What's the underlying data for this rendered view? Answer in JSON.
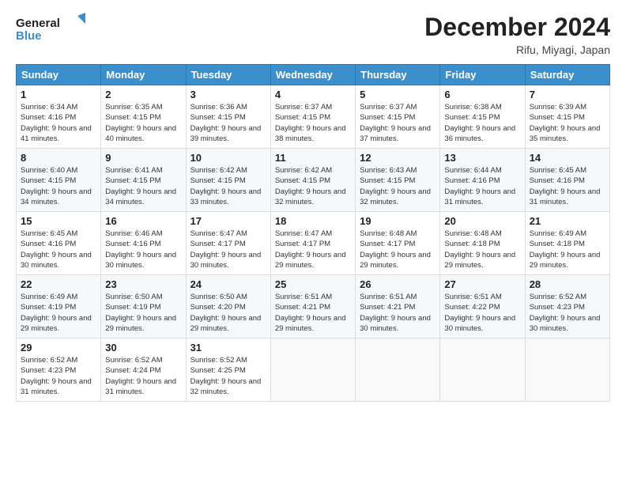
{
  "header": {
    "logo_line1": "General",
    "logo_line2": "Blue",
    "month_title": "December 2024",
    "location": "Rifu, Miyagi, Japan"
  },
  "days_of_week": [
    "Sunday",
    "Monday",
    "Tuesday",
    "Wednesday",
    "Thursday",
    "Friday",
    "Saturday"
  ],
  "weeks": [
    [
      {
        "day": "1",
        "sunrise": "Sunrise: 6:34 AM",
        "sunset": "Sunset: 4:16 PM",
        "daylight": "Daylight: 9 hours and 41 minutes."
      },
      {
        "day": "2",
        "sunrise": "Sunrise: 6:35 AM",
        "sunset": "Sunset: 4:15 PM",
        "daylight": "Daylight: 9 hours and 40 minutes."
      },
      {
        "day": "3",
        "sunrise": "Sunrise: 6:36 AM",
        "sunset": "Sunset: 4:15 PM",
        "daylight": "Daylight: 9 hours and 39 minutes."
      },
      {
        "day": "4",
        "sunrise": "Sunrise: 6:37 AM",
        "sunset": "Sunset: 4:15 PM",
        "daylight": "Daylight: 9 hours and 38 minutes."
      },
      {
        "day": "5",
        "sunrise": "Sunrise: 6:37 AM",
        "sunset": "Sunset: 4:15 PM",
        "daylight": "Daylight: 9 hours and 37 minutes."
      },
      {
        "day": "6",
        "sunrise": "Sunrise: 6:38 AM",
        "sunset": "Sunset: 4:15 PM",
        "daylight": "Daylight: 9 hours and 36 minutes."
      },
      {
        "day": "7",
        "sunrise": "Sunrise: 6:39 AM",
        "sunset": "Sunset: 4:15 PM",
        "daylight": "Daylight: 9 hours and 35 minutes."
      }
    ],
    [
      {
        "day": "8",
        "sunrise": "Sunrise: 6:40 AM",
        "sunset": "Sunset: 4:15 PM",
        "daylight": "Daylight: 9 hours and 34 minutes."
      },
      {
        "day": "9",
        "sunrise": "Sunrise: 6:41 AM",
        "sunset": "Sunset: 4:15 PM",
        "daylight": "Daylight: 9 hours and 34 minutes."
      },
      {
        "day": "10",
        "sunrise": "Sunrise: 6:42 AM",
        "sunset": "Sunset: 4:15 PM",
        "daylight": "Daylight: 9 hours and 33 minutes."
      },
      {
        "day": "11",
        "sunrise": "Sunrise: 6:42 AM",
        "sunset": "Sunset: 4:15 PM",
        "daylight": "Daylight: 9 hours and 32 minutes."
      },
      {
        "day": "12",
        "sunrise": "Sunrise: 6:43 AM",
        "sunset": "Sunset: 4:15 PM",
        "daylight": "Daylight: 9 hours and 32 minutes."
      },
      {
        "day": "13",
        "sunrise": "Sunrise: 6:44 AM",
        "sunset": "Sunset: 4:16 PM",
        "daylight": "Daylight: 9 hours and 31 minutes."
      },
      {
        "day": "14",
        "sunrise": "Sunrise: 6:45 AM",
        "sunset": "Sunset: 4:16 PM",
        "daylight": "Daylight: 9 hours and 31 minutes."
      }
    ],
    [
      {
        "day": "15",
        "sunrise": "Sunrise: 6:45 AM",
        "sunset": "Sunset: 4:16 PM",
        "daylight": "Daylight: 9 hours and 30 minutes."
      },
      {
        "day": "16",
        "sunrise": "Sunrise: 6:46 AM",
        "sunset": "Sunset: 4:16 PM",
        "daylight": "Daylight: 9 hours and 30 minutes."
      },
      {
        "day": "17",
        "sunrise": "Sunrise: 6:47 AM",
        "sunset": "Sunset: 4:17 PM",
        "daylight": "Daylight: 9 hours and 30 minutes."
      },
      {
        "day": "18",
        "sunrise": "Sunrise: 6:47 AM",
        "sunset": "Sunset: 4:17 PM",
        "daylight": "Daylight: 9 hours and 29 minutes."
      },
      {
        "day": "19",
        "sunrise": "Sunrise: 6:48 AM",
        "sunset": "Sunset: 4:17 PM",
        "daylight": "Daylight: 9 hours and 29 minutes."
      },
      {
        "day": "20",
        "sunrise": "Sunrise: 6:48 AM",
        "sunset": "Sunset: 4:18 PM",
        "daylight": "Daylight: 9 hours and 29 minutes."
      },
      {
        "day": "21",
        "sunrise": "Sunrise: 6:49 AM",
        "sunset": "Sunset: 4:18 PM",
        "daylight": "Daylight: 9 hours and 29 minutes."
      }
    ],
    [
      {
        "day": "22",
        "sunrise": "Sunrise: 6:49 AM",
        "sunset": "Sunset: 4:19 PM",
        "daylight": "Daylight: 9 hours and 29 minutes."
      },
      {
        "day": "23",
        "sunrise": "Sunrise: 6:50 AM",
        "sunset": "Sunset: 4:19 PM",
        "daylight": "Daylight: 9 hours and 29 minutes."
      },
      {
        "day": "24",
        "sunrise": "Sunrise: 6:50 AM",
        "sunset": "Sunset: 4:20 PM",
        "daylight": "Daylight: 9 hours and 29 minutes."
      },
      {
        "day": "25",
        "sunrise": "Sunrise: 6:51 AM",
        "sunset": "Sunset: 4:21 PM",
        "daylight": "Daylight: 9 hours and 29 minutes."
      },
      {
        "day": "26",
        "sunrise": "Sunrise: 6:51 AM",
        "sunset": "Sunset: 4:21 PM",
        "daylight": "Daylight: 9 hours and 30 minutes."
      },
      {
        "day": "27",
        "sunrise": "Sunrise: 6:51 AM",
        "sunset": "Sunset: 4:22 PM",
        "daylight": "Daylight: 9 hours and 30 minutes."
      },
      {
        "day": "28",
        "sunrise": "Sunrise: 6:52 AM",
        "sunset": "Sunset: 4:23 PM",
        "daylight": "Daylight: 9 hours and 30 minutes."
      }
    ],
    [
      {
        "day": "29",
        "sunrise": "Sunrise: 6:52 AM",
        "sunset": "Sunset: 4:23 PM",
        "daylight": "Daylight: 9 hours and 31 minutes."
      },
      {
        "day": "30",
        "sunrise": "Sunrise: 6:52 AM",
        "sunset": "Sunset: 4:24 PM",
        "daylight": "Daylight: 9 hours and 31 minutes."
      },
      {
        "day": "31",
        "sunrise": "Sunrise: 6:52 AM",
        "sunset": "Sunset: 4:25 PM",
        "daylight": "Daylight: 9 hours and 32 minutes."
      },
      null,
      null,
      null,
      null
    ]
  ]
}
